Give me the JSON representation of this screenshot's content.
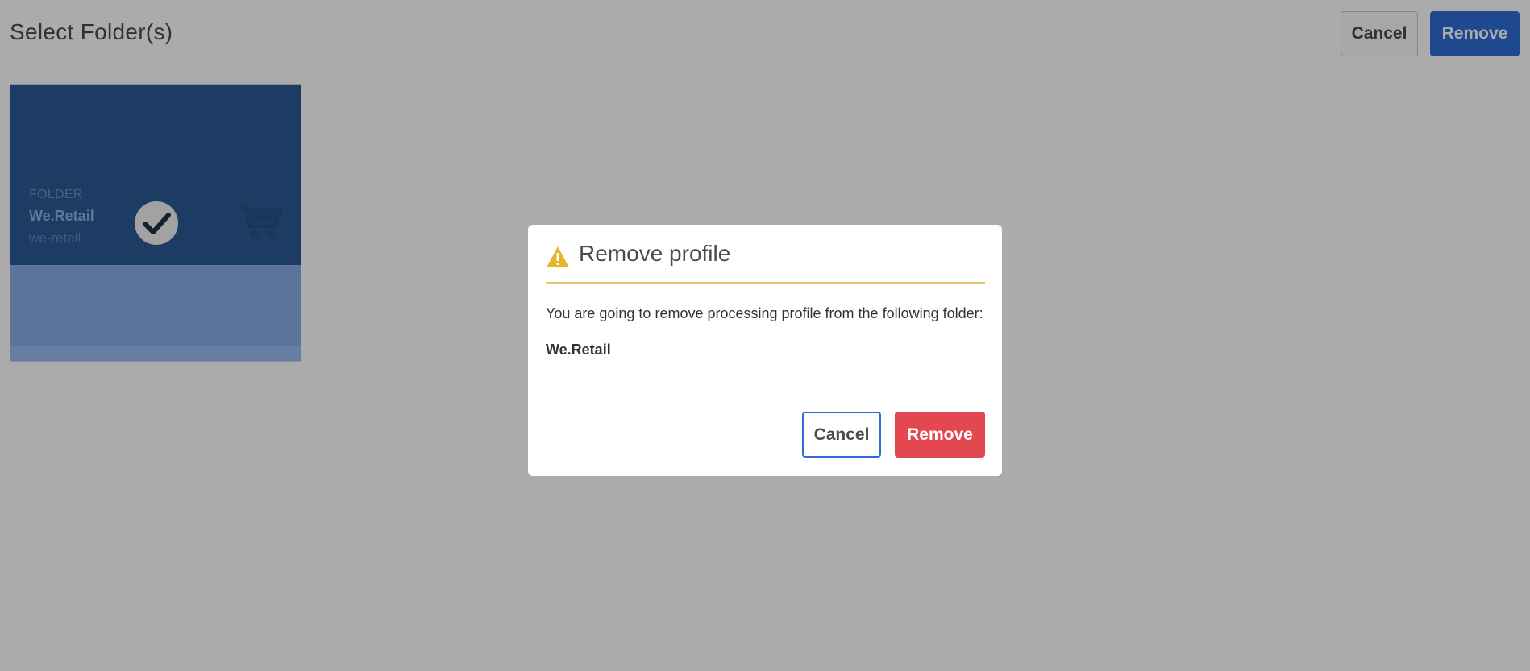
{
  "header": {
    "title": "Select Folder(s)",
    "cancel_label": "Cancel",
    "remove_label": "Remove"
  },
  "folder_card": {
    "type": "FOLDER",
    "name": "We.Retail",
    "path": "we-retail",
    "selected": true,
    "icons": [
      "checkmark-circle-icon",
      "shopping-cart-icon"
    ]
  },
  "dialog": {
    "title": "Remove profile",
    "icon": "warning-icon",
    "message": "You are going to remove processing profile from the following folder:",
    "folder": "We.Retail",
    "cancel_label": "Cancel",
    "remove_label": "Remove"
  },
  "colors": {
    "primary_blue": "#2d6ed4",
    "destructive_red": "#e34850",
    "warning_yellow": "#e8c66b"
  }
}
